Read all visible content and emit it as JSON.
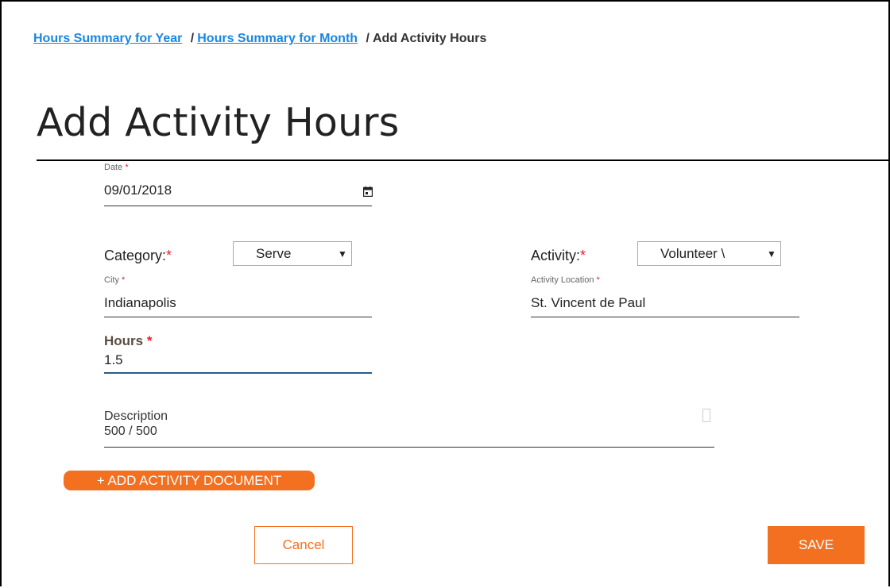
{
  "breadcrumb": {
    "year_link": "Hours Summary for Year",
    "month_link": "Hours Summary for Month",
    "separator": "/",
    "current": "Add Activity Hours"
  },
  "page": {
    "title": "Add Activity Hours"
  },
  "form": {
    "date": {
      "label": "Date",
      "required_mark": "*",
      "value": "09/01/2018",
      "icon": "calendar-icon"
    },
    "category": {
      "label": "Category:",
      "required_mark": "*",
      "selected": "Serve"
    },
    "activity": {
      "label": "Activity:",
      "required_mark": "*",
      "selected": "Volunteer \\"
    },
    "city": {
      "label": "City",
      "required_mark": "*",
      "value": "Indianapolis"
    },
    "location": {
      "label": "Activity Location",
      "required_mark": "*",
      "value": "St. Vincent de Paul"
    },
    "hours": {
      "label": "Hours",
      "required_mark": "*",
      "value": "1.5"
    },
    "description": {
      "label": "Description",
      "counter": "500 / 500"
    }
  },
  "buttons": {
    "add_document": "+ ADD ACTIVITY DOCUMENT",
    "cancel": "Cancel",
    "save": "SAVE"
  },
  "colors": {
    "accent": "#f37021",
    "link": "#1a86e0",
    "required": "#e02424",
    "focus_underline": "#2c5a8a"
  }
}
